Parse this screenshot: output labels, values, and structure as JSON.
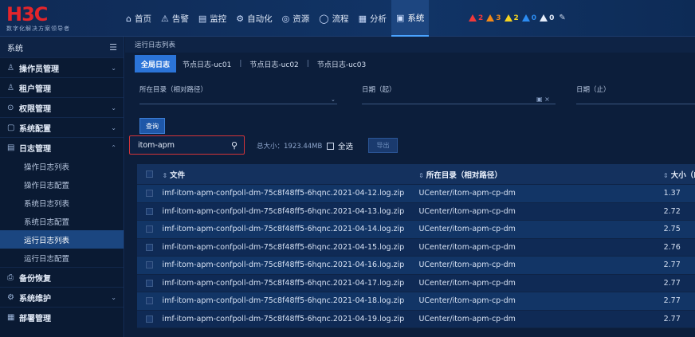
{
  "brand": {
    "logo_text": "H3C",
    "tagline": "数字化解决方案领导者"
  },
  "nav": [
    {
      "icon": "⌂",
      "label": "首页"
    },
    {
      "icon": "⚠",
      "label": "告警"
    },
    {
      "icon": "▤",
      "label": "监控"
    },
    {
      "icon": "⚙",
      "label": "自动化"
    },
    {
      "icon": "◎",
      "label": "资源"
    },
    {
      "icon": "◯",
      "label": "流程"
    },
    {
      "icon": "▦",
      "label": "分析"
    },
    {
      "icon": "▣",
      "label": "系统"
    }
  ],
  "alarms": [
    {
      "count": "2",
      "color": "#f0393b"
    },
    {
      "count": "3",
      "color": "#f28a1a"
    },
    {
      "count": "2",
      "color": "#f5d320"
    },
    {
      "count": "0",
      "color": "#2c8cf2"
    },
    {
      "count": "0",
      "color": "#e5edfa"
    }
  ],
  "sidebar": {
    "title": "系统",
    "items": [
      {
        "icon": "♙",
        "label": "操作员管理",
        "chevron": "⌄"
      },
      {
        "icon": "♙",
        "label": "租户管理",
        "chevron": ""
      },
      {
        "icon": "⊙",
        "label": "权限管理",
        "chevron": "⌄"
      },
      {
        "icon": "▢",
        "label": "系统配置",
        "chevron": "⌄"
      },
      {
        "icon": "▤",
        "label": "日志管理",
        "chevron": "⌃"
      }
    ],
    "subitems": [
      "操作日志列表",
      "操作日志配置",
      "系统日志列表",
      "系统日志配置",
      "运行日志列表",
      "运行日志配置"
    ],
    "bottom_items": [
      {
        "icon": "⎙",
        "label": "备份恢复",
        "chevron": ""
      },
      {
        "icon": "⚙",
        "label": "系统维护",
        "chevron": "⌄"
      },
      {
        "icon": "▦",
        "label": "部署管理",
        "chevron": ""
      }
    ]
  },
  "breadcrumb": "运行日志列表",
  "tabs": [
    "全局日志",
    "节点日志-uc01",
    "节点日志-uc02",
    "节点日志-uc03"
  ],
  "filters": {
    "dir_label": "所在目录（相对路径）",
    "date_from_label": "日期（起）",
    "date_to_label": "日期（止）"
  },
  "query_button": "查询",
  "search": {
    "value": "itom-apm"
  },
  "total_size": "总大小：1923.44MB",
  "select_all_label": "全选",
  "export_button": "导出",
  "table": {
    "headers": [
      "文件",
      "所在目录（相对路径）",
      "大小（M"
    ],
    "rows": [
      {
        "file": "imf-itom-apm-confpoll-dm-75c8f48ff5-6hqnc.2021-04-12.log.zip",
        "dir": "UCenter/itom-apm-cp-dm",
        "size": "1.37"
      },
      {
        "file": "imf-itom-apm-confpoll-dm-75c8f48ff5-6hqnc.2021-04-13.log.zip",
        "dir": "UCenter/itom-apm-cp-dm",
        "size": "2.72"
      },
      {
        "file": "imf-itom-apm-confpoll-dm-75c8f48ff5-6hqnc.2021-04-14.log.zip",
        "dir": "UCenter/itom-apm-cp-dm",
        "size": "2.75"
      },
      {
        "file": "imf-itom-apm-confpoll-dm-75c8f48ff5-6hqnc.2021-04-15.log.zip",
        "dir": "UCenter/itom-apm-cp-dm",
        "size": "2.76"
      },
      {
        "file": "imf-itom-apm-confpoll-dm-75c8f48ff5-6hqnc.2021-04-16.log.zip",
        "dir": "UCenter/itom-apm-cp-dm",
        "size": "2.77"
      },
      {
        "file": "imf-itom-apm-confpoll-dm-75c8f48ff5-6hqnc.2021-04-17.log.zip",
        "dir": "UCenter/itom-apm-cp-dm",
        "size": "2.77"
      },
      {
        "file": "imf-itom-apm-confpoll-dm-75c8f48ff5-6hqnc.2021-04-18.log.zip",
        "dir": "UCenter/itom-apm-cp-dm",
        "size": "2.77"
      },
      {
        "file": "imf-itom-apm-confpoll-dm-75c8f48ff5-6hqnc.2021-04-19.log.zip",
        "dir": "UCenter/itom-apm-cp-dm",
        "size": "2.77"
      }
    ]
  }
}
